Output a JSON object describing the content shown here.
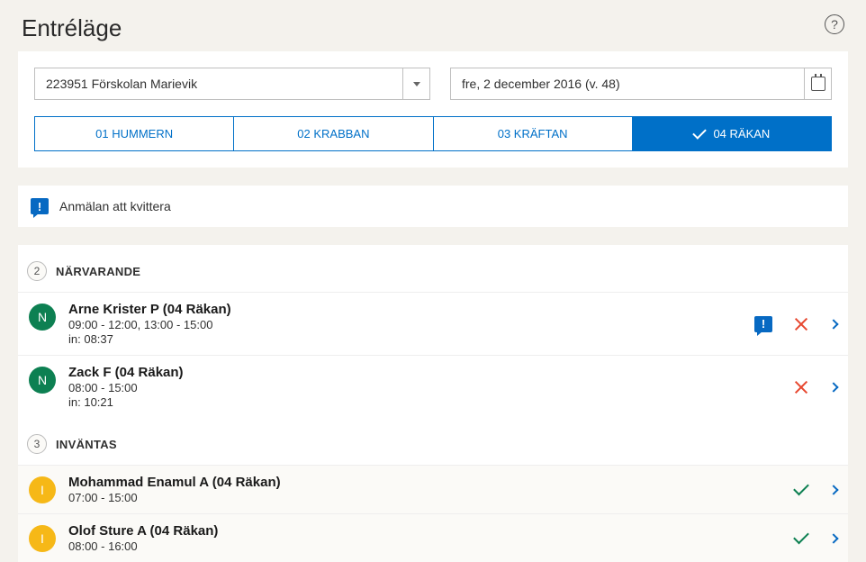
{
  "header": {
    "title": "Entréläge"
  },
  "filters": {
    "school": "223951 Förskolan Marievik",
    "date": "fre, 2 december 2016 (v. 48)"
  },
  "tabs": [
    {
      "label": "01 HUMMERN",
      "active": false
    },
    {
      "label": "02 KRABBAN",
      "active": false
    },
    {
      "label": "03 KRÄFTAN",
      "active": false
    },
    {
      "label": "04 RÄKAN",
      "active": true
    }
  ],
  "notice": "Anmälan att kvittera",
  "sections": {
    "present": {
      "count": "2",
      "title": "NÄRVARANDE",
      "avatar_letter": "N",
      "items": [
        {
          "name": "Arne Krister P (04 Räkan)",
          "time": "09:00 - 12:00, 13:00 - 15:00",
          "in": "in: 08:37",
          "has_alert": true
        },
        {
          "name": "Zack F (04 Räkan)",
          "time": "08:00 - 15:00",
          "in": "in: 10:21",
          "has_alert": false
        }
      ]
    },
    "waiting": {
      "count": "3",
      "title": "INVÄNTAS",
      "avatar_letter": "I",
      "items": [
        {
          "name": "Mohammad Enamul A (04 Räkan)",
          "time": "07:00 - 15:00"
        },
        {
          "name": "Olof Sture A (04 Räkan)",
          "time": "08:00 - 16:00"
        }
      ]
    }
  }
}
